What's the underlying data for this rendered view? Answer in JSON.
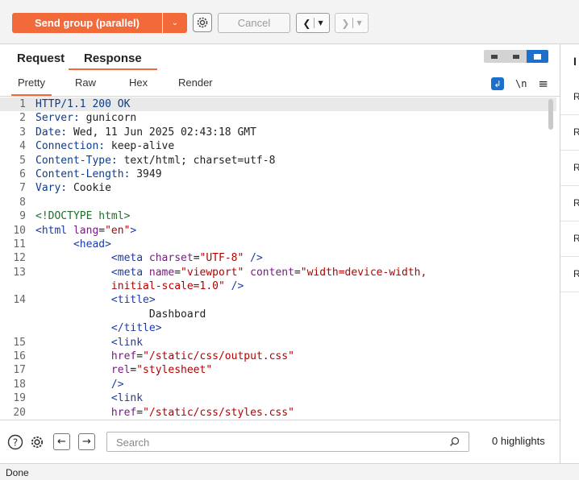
{
  "toolbar": {
    "send_label": "Send group (parallel)",
    "cancel_label": "Cancel"
  },
  "tabs": {
    "request": "Request",
    "response": "Response",
    "pretty": "Pretty",
    "raw": "Raw",
    "hex": "Hex",
    "render": "Render",
    "newline_toggle": "\\n"
  },
  "editor": {
    "lines": [
      {
        "n": "1",
        "h": "<span class='k'>HTTP/1.1 200 OK</span>"
      },
      {
        "n": "2",
        "h": "<span class='k'>Server:</span> gunicorn"
      },
      {
        "n": "3",
        "h": "<span class='k'>Date:</span> Wed, 11 Jun 2025 02:43:18 GMT"
      },
      {
        "n": "4",
        "h": "<span class='k'>Connection:</span> keep-alive"
      },
      {
        "n": "5",
        "h": "<span class='k'>Content-Type:</span> text/html; charset=utf-8"
      },
      {
        "n": "6",
        "h": "<span class='k'>Content-Length:</span> 3949"
      },
      {
        "n": "7",
        "h": "<span class='k'>Vary:</span> Cookie"
      },
      {
        "n": "8",
        "h": ""
      },
      {
        "n": "9",
        "h": "<span class='t'>&lt;!DOCTYPE html&gt;</span>"
      },
      {
        "n": "10",
        "h": "<span class='tg'>&lt;html</span> <span class='a'>lang</span>=<span class='v'>\"en\"</span><span class='tg'>&gt;</span>"
      },
      {
        "n": "11",
        "h": "      <span class='tg'>&lt;head&gt;</span>"
      },
      {
        "n": "12",
        "h": "            <span class='tg'>&lt;meta</span> <span class='a'>charset</span>=<span class='v'>\"UTF-8\"</span> <span class='tg'>/&gt;</span>"
      },
      {
        "n": "13",
        "h": "            <span class='tg'>&lt;meta</span> <span class='a'>name</span>=<span class='v'>\"viewport\"</span> <span class='a'>content</span>=<span class='v'>\"width=device-width,</span>"
      },
      {
        "n": "",
        "h": "            <span class='v'>initial-scale=1.0\"</span> <span class='tg'>/&gt;</span>"
      },
      {
        "n": "14",
        "h": "            <span class='tg'>&lt;title&gt;</span>"
      },
      {
        "n": "",
        "h": "                  Dashboard"
      },
      {
        "n": "",
        "h": "            <span class='tg'>&lt;/title&gt;</span>"
      },
      {
        "n": "15",
        "h": "            <span class='tg'>&lt;link</span>"
      },
      {
        "n": "16",
        "h": "            <span class='a'>href</span>=<span class='v'>\"/static/css/output.css\"</span>"
      },
      {
        "n": "17",
        "h": "            <span class='a'>rel</span>=<span class='v'>\"stylesheet\"</span>"
      },
      {
        "n": "18",
        "h": "            <span class='tg'>/&gt;</span>"
      },
      {
        "n": "19",
        "h": "            <span class='tg'>&lt;link</span>"
      },
      {
        "n": "20",
        "h": "            <span class='a'>href</span>=<span class='v'>\"/static/css/styles.css\"</span>"
      }
    ]
  },
  "search": {
    "placeholder": "Search",
    "highlights": "0 highlights"
  },
  "status": {
    "text": "Done"
  },
  "inspector": {
    "title_partial": "I",
    "row_letters": [
      "R",
      "R",
      "R",
      "R",
      "R",
      "R"
    ]
  },
  "colors": {
    "accent": "#f26a3a",
    "blue": "#1d6fcc"
  },
  "icons": [
    "settings-gear-icon",
    "chevron-down-icon",
    "back-icon",
    "forward-icon",
    "help-icon",
    "arrow-left-icon",
    "arrow-right-icon",
    "search-icon",
    "word-wrap-icon",
    "menu-icon"
  ]
}
